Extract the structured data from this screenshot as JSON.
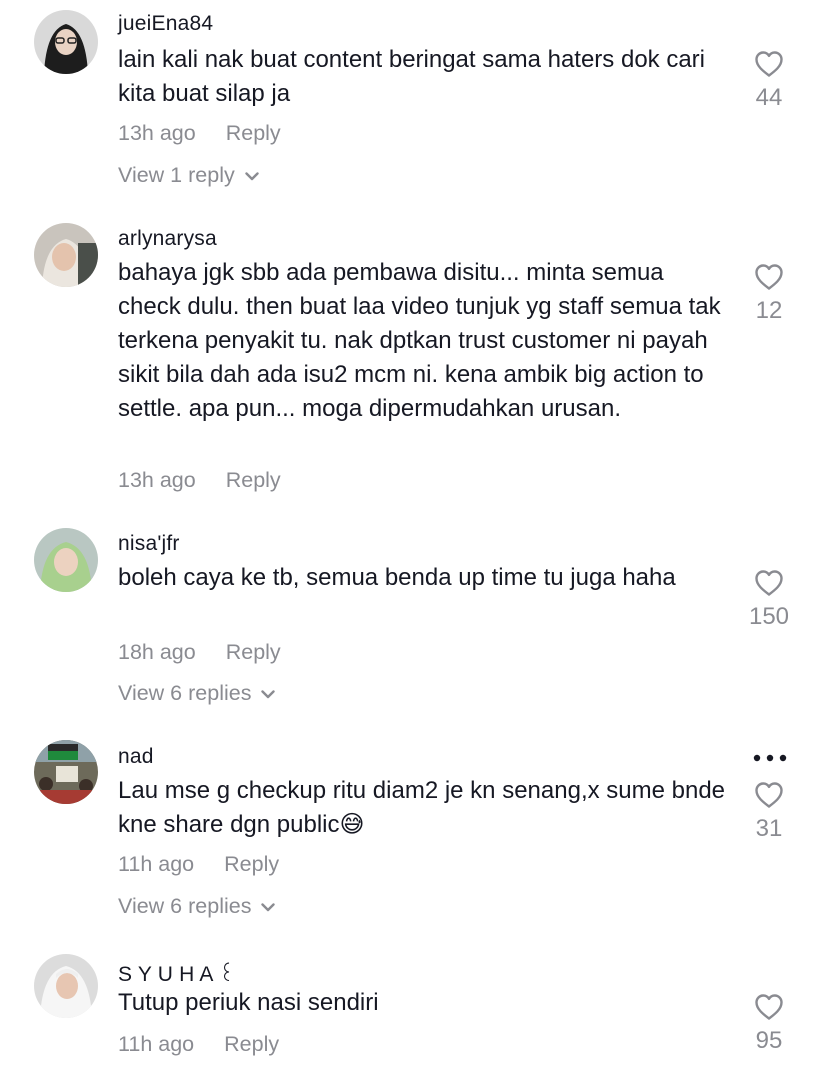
{
  "comments": [
    {
      "username": "jueiEna84",
      "text": "lain kali nak buat content beringat sama haters dok cari kita buat silap ja",
      "time": "13h ago",
      "reply": "Reply",
      "likes": "44",
      "view_replies": "View 1 reply"
    },
    {
      "username": "arlynarysa",
      "text": "bahaya jgk sbb ada pembawa disitu... minta semua check dulu. then buat laa video tunjuk yg staff semua tak terkena penyakit tu. nak dptkan trust customer ni payah sikit bila dah ada isu2 mcm ni. kena ambik big action to settle. apa pun... moga dipermudahkan urusan.",
      "time": "13h ago",
      "reply": "Reply",
      "likes": "12"
    },
    {
      "username": "nisa'jfr",
      "text": "boleh caya ke tb, semua benda up time tu juga haha",
      "time": "18h ago",
      "reply": "Reply",
      "likes": "150",
      "view_replies": "View 6 replies"
    },
    {
      "username": "nad",
      "text": "Lau mse g checkup ritu diam2 je kn senang,x sume bnde kne share dgn public😅",
      "time": "11h ago",
      "reply": "Reply",
      "likes": "31",
      "view_replies": "View 6 replies"
    },
    {
      "username": "S Y U H A ꒰",
      "text": "Tutup periuk nasi sendiri",
      "time": "11h ago",
      "reply": "Reply",
      "likes": "95"
    }
  ],
  "icons": {
    "like": "heart-outline-icon",
    "expand": "chevron-down-icon",
    "more": "more-options-icon"
  },
  "colors": {
    "primary_text": "#161823",
    "secondary_text": "#8a8b91"
  }
}
